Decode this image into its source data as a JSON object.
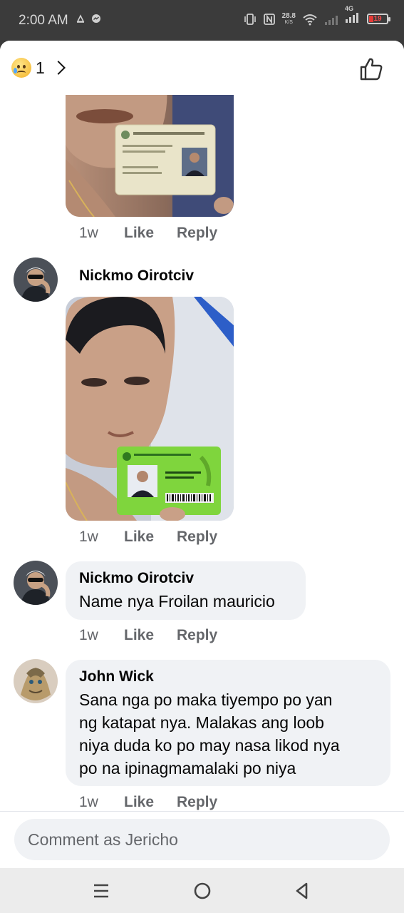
{
  "status_bar": {
    "time": "2:00 AM",
    "network_speed": "28.8",
    "network_unit": "K/S",
    "network_type": "4G",
    "battery": "19"
  },
  "header": {
    "reaction_emoji": "sad-face-emoji",
    "reaction_count": "1",
    "like_icon": "thumbs-up-icon"
  },
  "comments": [
    {
      "type": "photo",
      "meta": {
        "time": "1w",
        "like": "Like",
        "reply": "Reply"
      }
    },
    {
      "type": "photo",
      "author": "Nickmo Oirotciv",
      "meta": {
        "time": "1w",
        "like": "Like",
        "reply": "Reply"
      }
    },
    {
      "type": "text",
      "author": "Nickmo Oirotciv",
      "lines": [
        "Name nya Froilan mauricio"
      ],
      "meta": {
        "time": "1w",
        "like": "Like",
        "reply": "Reply"
      }
    },
    {
      "type": "text",
      "author": "John Wick",
      "lines": [
        "Sana nga po maka tiyempo po yan",
        "ng katapat nya. Malakas ang loob",
        "niya duda ko po may nasa likod nya",
        "po na ipinagmamalaki po niya"
      ],
      "meta": {
        "time": "1w",
        "like": "Like",
        "reply": "Reply"
      }
    }
  ],
  "composer": {
    "placeholder": "Comment as Jericho"
  },
  "navbar": {
    "icons": [
      "menu-icon",
      "home-circle-icon",
      "back-triangle-icon"
    ]
  }
}
